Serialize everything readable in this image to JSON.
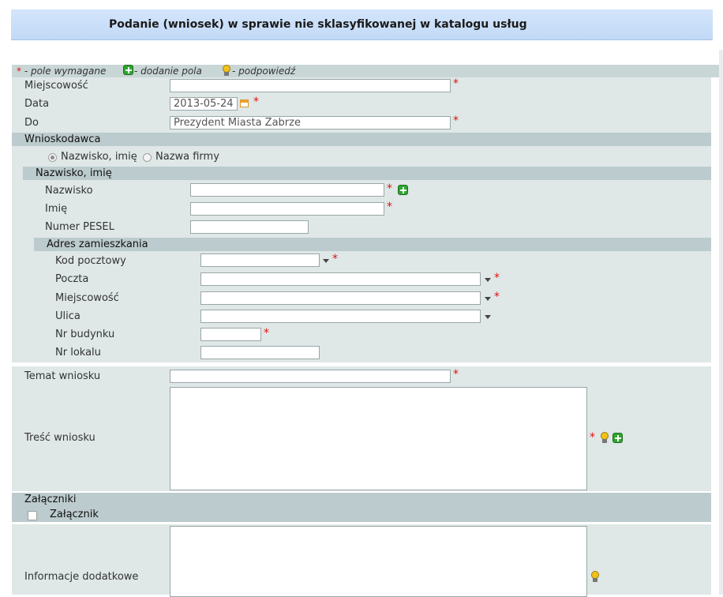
{
  "header": {
    "title": "Podanie (wniosek) w sprawie nie sklasyfikowanej w katalogu usług"
  },
  "legend": {
    "required_star": "*",
    "required_text": " - pole wymagane",
    "add_text": " - dodanie pola",
    "hint_text": " - podpowiedź"
  },
  "fields": {
    "miejscowosc": {
      "label": "Miejscowość",
      "value": ""
    },
    "data": {
      "label": "Data",
      "value": "2013-05-24"
    },
    "do": {
      "label": "Do",
      "value": "Prezydent Miasta Zabrze"
    }
  },
  "applicant": {
    "section_title": "Wnioskodawca",
    "type_options": [
      "Nazwisko, imię",
      "Nazwa firmy"
    ],
    "type_selected": "Nazwisko, imię",
    "person": {
      "section_title": "Nazwisko, imię",
      "nazwisko": "Nazwisko",
      "imie": "Imię",
      "pesel": "Numer PESEL"
    },
    "address": {
      "section_title": "Adres zamieszkania",
      "kod_pocztowy": "Kod pocztowy",
      "poczta": "Poczta",
      "miejscowosc": "Miejscowość",
      "ulica": "Ulica",
      "nr_budynku": "Nr budynku",
      "nr_lokalu": "Nr lokalu"
    }
  },
  "request": {
    "temat_label": "Temat wniosku",
    "tresc_label": "Treść wniosku"
  },
  "attachments": {
    "section_title": "Załączniki",
    "checkbox_label": "Załącznik"
  },
  "extra": {
    "label": "Informacje dodatkowe"
  },
  "colors": {
    "title_bar": "#c9ddf8",
    "panel": "#dfe7e7",
    "section": "#bccbcd",
    "required": "#e01010",
    "add_icon": "#2fa52f",
    "hint_icon": "#f2c21a"
  },
  "icons": {
    "add": "plus-icon",
    "hint": "bulb-icon",
    "calendar": "calendar-icon",
    "dropdown": "chevron-down-icon"
  }
}
